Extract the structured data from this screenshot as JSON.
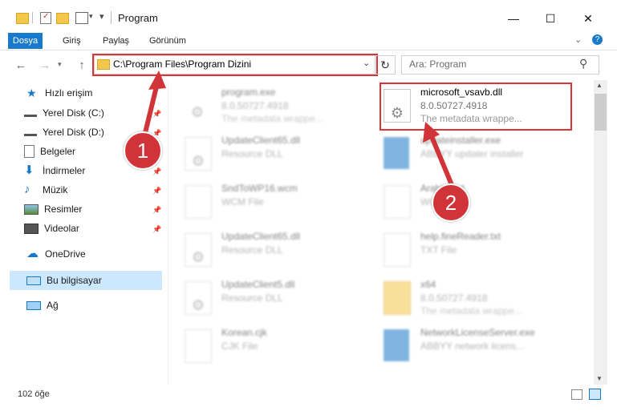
{
  "window": {
    "title": "Program",
    "controls": {
      "minimize": "—",
      "maximize": "☐",
      "close": "✕"
    }
  },
  "ribbon": {
    "tabs": [
      "Dosya",
      "Giriş",
      "Paylaş",
      "Görünüm"
    ],
    "expand_icon": "chevron-down-icon",
    "help_icon": "?"
  },
  "address": {
    "path": "C:\\Program Files\\Program Dizini",
    "search_placeholder": "Ara: Program"
  },
  "sidebar": {
    "quick_access": "Hızlı erişim",
    "items": [
      {
        "label": "Yerel Disk (C:)"
      },
      {
        "label": "Yerel Disk (D:)"
      },
      {
        "label": "Belgeler"
      },
      {
        "label": "İndirmeler"
      },
      {
        "label": "Müzik"
      },
      {
        "label": "Resimler"
      },
      {
        "label": "Videolar"
      }
    ],
    "onedrive": "OneDrive",
    "this_pc": "Bu bilgisayar",
    "network": "Ağ"
  },
  "files": {
    "left": [
      {
        "name": "program.exe",
        "line1": "8.0.50727.4918",
        "line2": "The metadata wrappe..."
      },
      {
        "name": "UpdateClient65.dll",
        "line1": "Resource DLL",
        "line2": ""
      },
      {
        "name": "SndToWP16.wcm",
        "line1": "WCM File",
        "line2": ""
      },
      {
        "name": "UpdateClient65.dll",
        "line1": "Resource DLL",
        "line2": ""
      },
      {
        "name": "UpdateClient5.dll",
        "line1": "Resource DLL",
        "line2": ""
      },
      {
        "name": "Korean.cjk",
        "line1": "CJK File",
        "line2": ""
      }
    ],
    "right": [
      {
        "name": "microsoft_vsavb.dll",
        "line1": "8.0.50727.4918",
        "line2": "The metadata wrappe..."
      },
      {
        "name": "updateinstaller.exe",
        "line1": "ABBYY updater installer",
        "line2": ""
      },
      {
        "name": "Arabic.ard",
        "line1": "WCM File",
        "line2": ""
      },
      {
        "name": "help.fineReader.txt",
        "line1": "TXT File",
        "line2": ""
      },
      {
        "name": "x64",
        "line1": "8.0.50727.4918",
        "line2": "The metadata wrappe..."
      },
      {
        "name": "NetworkLicenseServer.exe",
        "line1": "ABBYY network licens...",
        "line2": ""
      }
    ]
  },
  "annotations": {
    "marker1": "1",
    "marker2": "2"
  },
  "status": {
    "count": "102 öğe"
  },
  "colors": {
    "accent": "#1979ca",
    "highlight": "#d9343a",
    "selected": "#cce8ff"
  }
}
